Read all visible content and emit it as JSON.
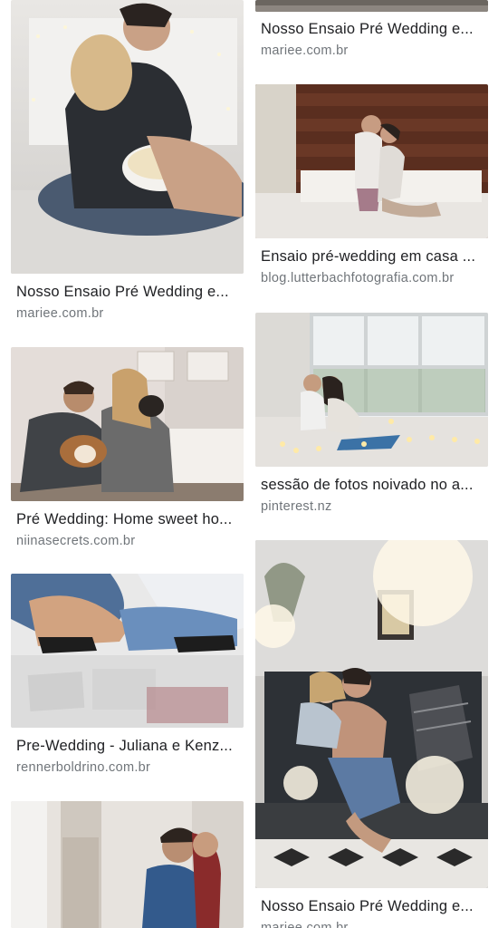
{
  "results": [
    {
      "title": "Nosso Ensaio Pré Wedding e...",
      "source": "mariee.com.br",
      "image": "couple-popcorn-bed-photo"
    },
    {
      "title": "Pré Wedding: Home sweet ho...",
      "source": "niinasecrets.com.br",
      "image": "couple-dog-sofa-photo"
    },
    {
      "title": "Pre-Wedding - Juliana e Kenz...",
      "source": "rennerboldrino.com.br",
      "image": "crossed-legs-sneakers-photo"
    },
    {
      "title": "",
      "source": "",
      "image": "couple-embrace-doorway-photo"
    },
    {
      "title": "Nosso Ensaio Pré Wedding e...",
      "source": "mariee.com.br",
      "image": "top-cropped-photo"
    },
    {
      "title": "Ensaio pré-wedding em casa ...",
      "source": "blog.lutterbachfotografia.com.br",
      "image": "couple-kiss-wood-wall-photo"
    },
    {
      "title": "sessão de fotos noivado no a...",
      "source": "pinterest.nz",
      "image": "couple-window-candles-photo"
    },
    {
      "title": "Nosso Ensaio Pré Wedding e...",
      "source": "mariee.com.br",
      "image": "couple-kiss-sofa-bokeh-photo"
    }
  ]
}
